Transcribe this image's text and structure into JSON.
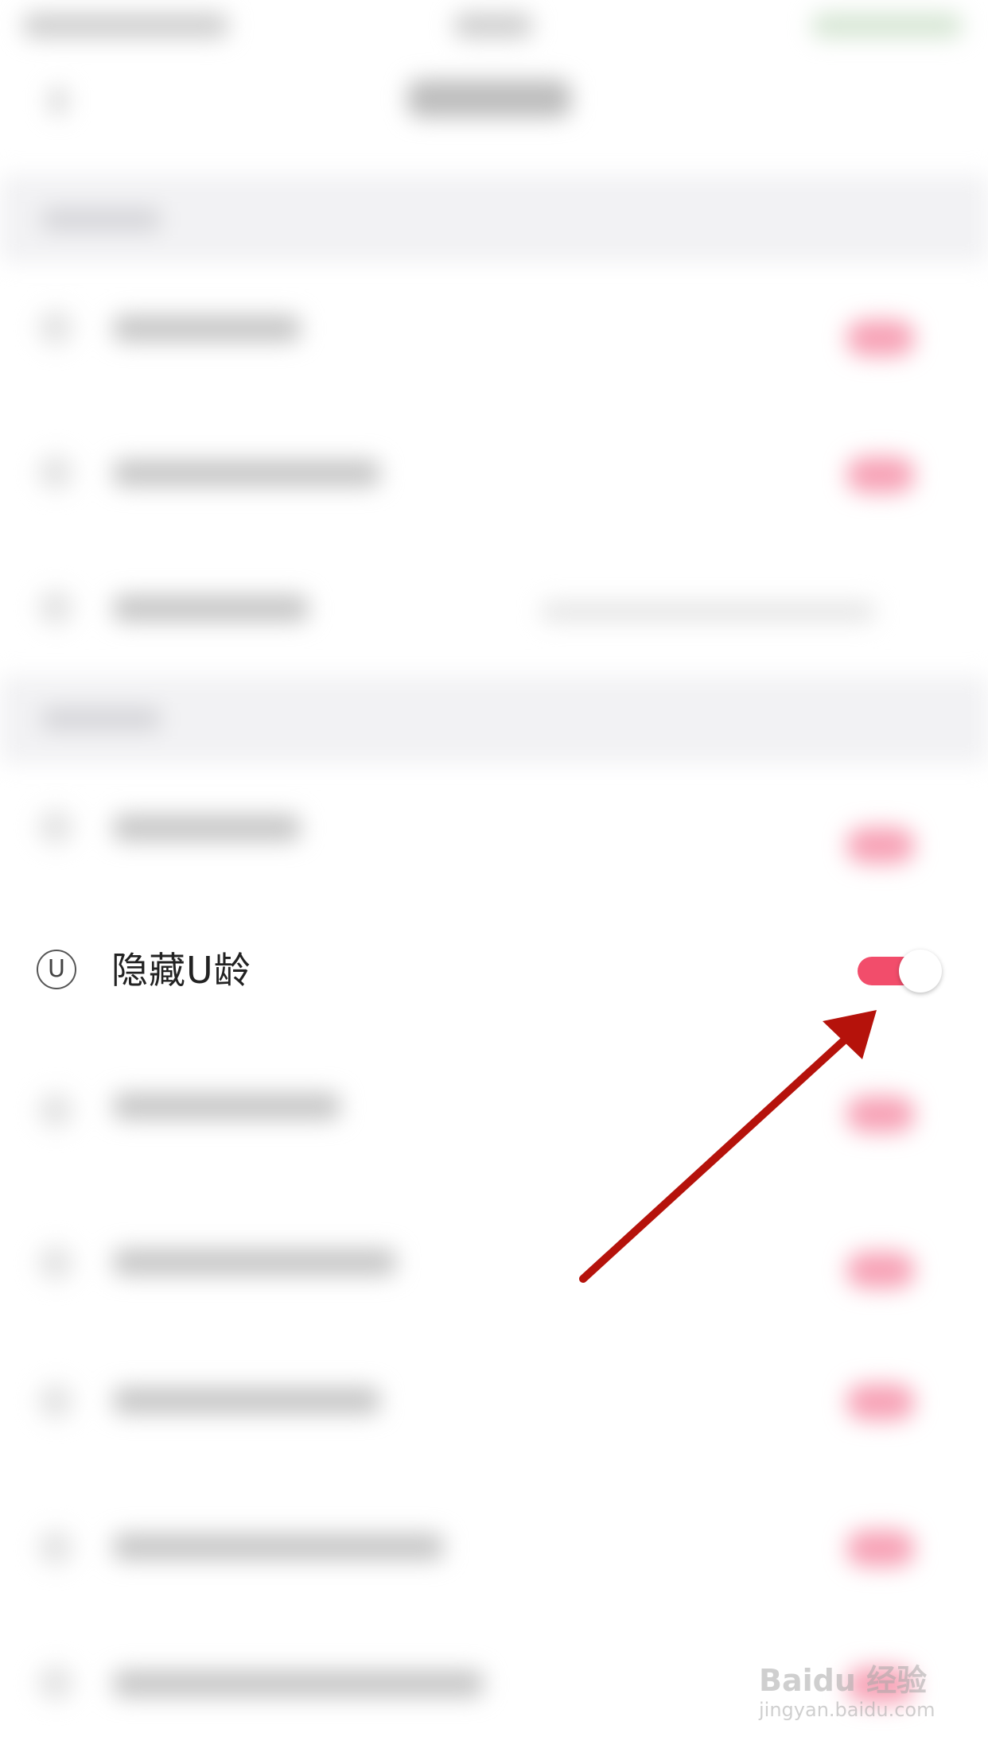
{
  "focused_row": {
    "icon": "u-circle-icon",
    "icon_glyph": "U",
    "label": "隐藏U龄",
    "toggle_on": true,
    "toggle_color": "#f24d6b"
  },
  "annotation": {
    "arrow_color": "#b5120b"
  },
  "watermark": {
    "line1": "Baidu 经验",
    "line2": "jingyan.baidu.com"
  }
}
